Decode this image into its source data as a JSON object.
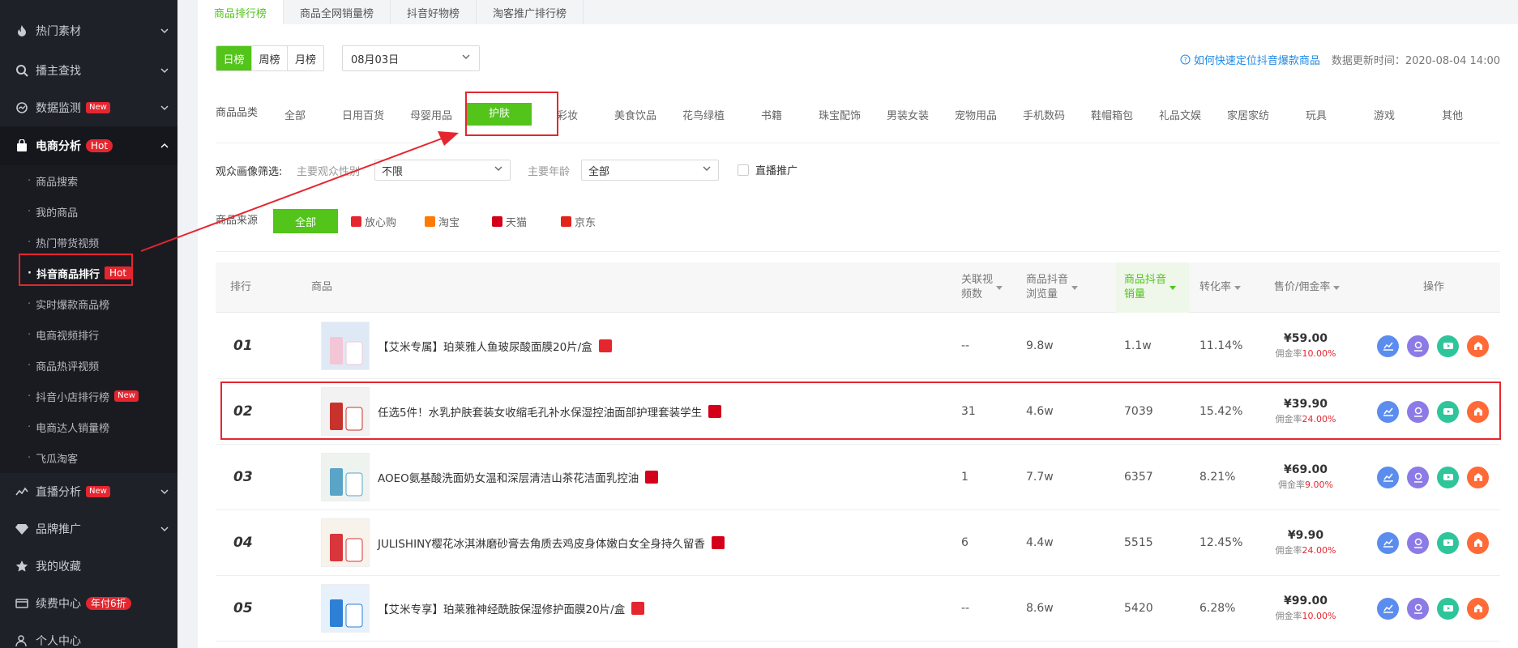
{
  "sidebar": {
    "items": [
      {
        "label": "热门素材",
        "icon": "flame-icon"
      },
      {
        "label": "播主查找",
        "icon": "search-icon"
      },
      {
        "label": "数据监测",
        "icon": "monitor-icon",
        "badge": "New"
      },
      {
        "label": "电商分析",
        "icon": "bag-icon",
        "badge": "Hot"
      }
    ],
    "sub_items": [
      {
        "label": "商品搜索"
      },
      {
        "label": "我的商品"
      },
      {
        "label": "热门带货视频"
      },
      {
        "label": "抖音商品排行",
        "badge": "Hot"
      },
      {
        "label": "实时爆款商品榜"
      },
      {
        "label": "电商视频排行"
      },
      {
        "label": "商品热评视频"
      },
      {
        "label": "抖音小店排行榜",
        "badge": "New"
      },
      {
        "label": "电商达人销量榜"
      },
      {
        "label": "飞瓜淘客"
      }
    ],
    "items_after": [
      {
        "label": "直播分析",
        "icon": "live-icon",
        "badge": "New"
      },
      {
        "label": "品牌推广",
        "icon": "diamond-icon"
      },
      {
        "label": "我的收藏",
        "icon": "star-icon"
      },
      {
        "label": "续费中心",
        "icon": "card-icon",
        "badge": "年付6折"
      },
      {
        "label": "个人中心",
        "icon": "user-icon"
      }
    ]
  },
  "tabs": [
    "商品排行榜",
    "商品全网销量榜",
    "抖音好物榜",
    "淘客推广排行榜"
  ],
  "period": [
    "日榜",
    "周榜",
    "月榜"
  ],
  "date": "08月03日",
  "help_link": "如何快速定位抖音爆款商品",
  "update_time": "数据更新时间：2020-08-04 14:00",
  "category_label": "商品品类",
  "categories": [
    "全部",
    "日用百货",
    "母婴用品",
    "护肤",
    "彩妆",
    "美食饮品",
    "花鸟绿植",
    "书籍",
    "珠宝配饰",
    "男装女装",
    "宠物用品",
    "手机数码",
    "鞋帽箱包",
    "礼品文娱",
    "家居家纺",
    "玩具",
    "游戏",
    "其他"
  ],
  "audience": {
    "label": "观众画像筛选:",
    "gender_label": "主要观众性别",
    "gender_value": "不限",
    "age_label": "主要年龄",
    "age_value": "全部",
    "live_label": "直播推广"
  },
  "source": {
    "label": "商品来源",
    "options": [
      "全部",
      "放心购",
      "淘宝",
      "天猫",
      "京东"
    ]
  },
  "table": {
    "headers": {
      "rank": "排行",
      "product": "商品",
      "videos": [
        "关联视",
        "频数"
      ],
      "views": [
        "商品抖音",
        "浏览量"
      ],
      "sales": [
        "商品抖音",
        "销量"
      ],
      "conv": "转化率",
      "price": "售价/佣金率",
      "ops": "操作"
    },
    "commission_prefix": "佣金率",
    "rows": [
      {
        "rank": "01",
        "name": "【艾米专属】珀莱雅人鱼玻尿酸面膜20片/盒",
        "shop": "放心购",
        "videos": "--",
        "views": "9.8w",
        "sales": "1.1w",
        "conv": "11.14%",
        "price": "¥59.00",
        "commission": "10.00%"
      },
      {
        "rank": "02",
        "name": "任选5件！水乳护肤套装女收缩毛孔补水保湿控油面部护理套装学生",
        "shop": "天猫",
        "videos": "31",
        "views": "4.6w",
        "sales": "7039",
        "conv": "15.42%",
        "price": "¥39.90",
        "commission": "24.00%"
      },
      {
        "rank": "03",
        "name": "AOEO氨基酸洗面奶女温和深层清洁山茶花洁面乳控油",
        "shop": "天猫",
        "videos": "1",
        "views": "7.7w",
        "sales": "6357",
        "conv": "8.21%",
        "price": "¥69.00",
        "commission": "9.00%"
      },
      {
        "rank": "04",
        "name": "JULISHINY樱花冰淇淋磨砂膏去角质去鸡皮身体嫩白女全身持久留香",
        "shop": "天猫",
        "videos": "6",
        "views": "4.4w",
        "sales": "5515",
        "conv": "12.45%",
        "price": "¥9.90",
        "commission": "24.00%"
      },
      {
        "rank": "05",
        "name": "【艾米专享】珀莱雅神经酰胺保湿修护面膜20片/盒",
        "shop": "放心购",
        "videos": "--",
        "views": "8.6w",
        "sales": "5420",
        "conv": "6.28%",
        "price": "¥99.00",
        "commission": "10.00%"
      }
    ]
  },
  "colors": {
    "accent": "#52c41a",
    "sidebar_bg": "#1f2129",
    "highlight": "#e5262f"
  }
}
